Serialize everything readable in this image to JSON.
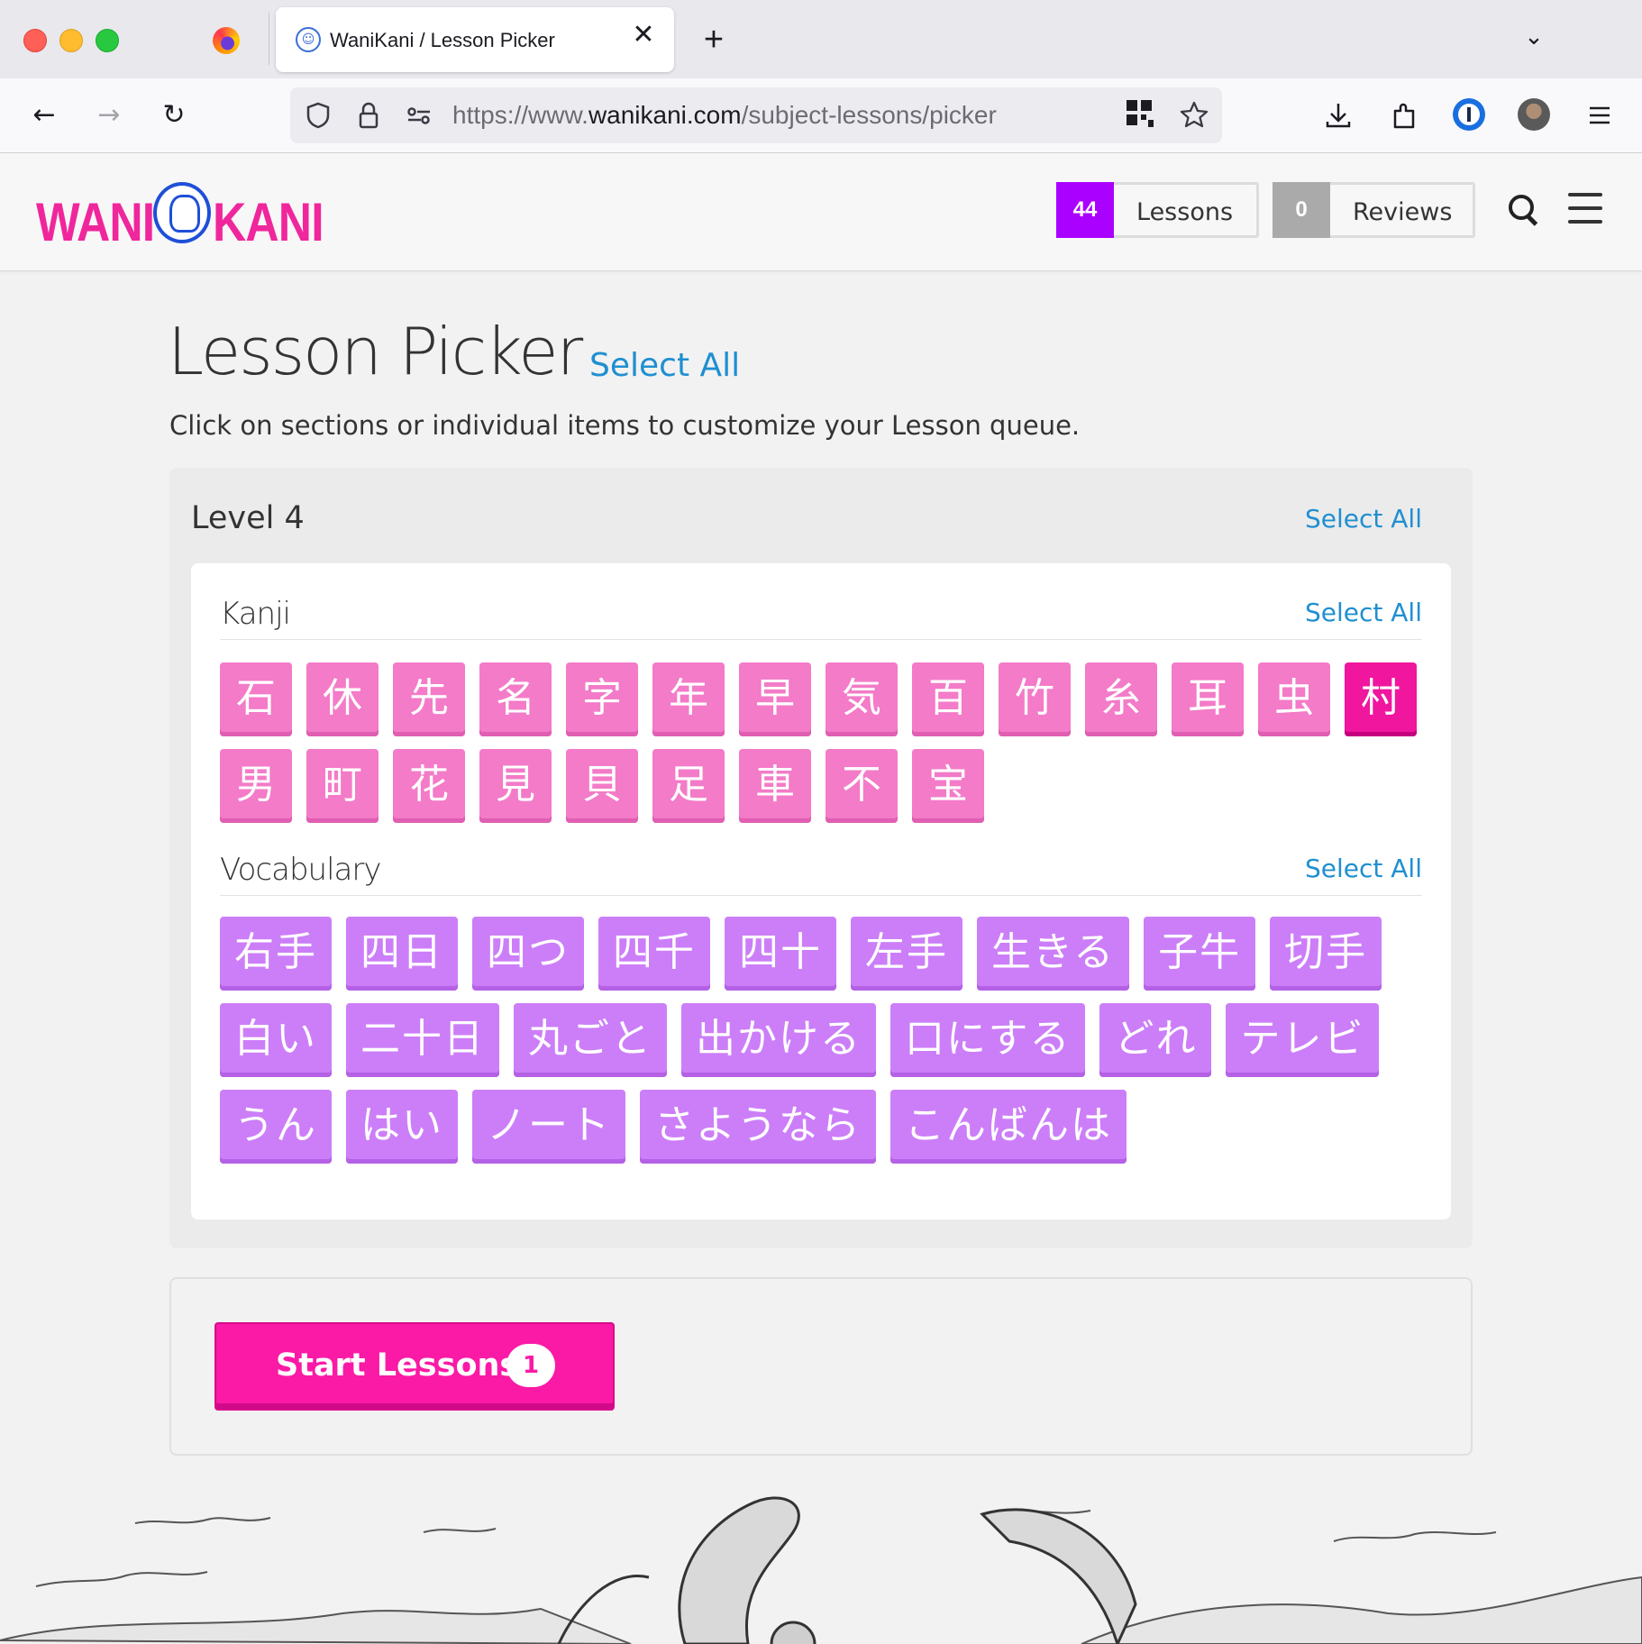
{
  "browser": {
    "tab_title": "WaniKani / Lesson Picker",
    "tab_close_glyph": "✕",
    "new_tab_glyph": "+",
    "tab_list_glyph": "⌄",
    "url_prefix": "https://www.",
    "url_host": "wanikani.com",
    "url_path": "/subject-lessons/picker",
    "nav": {
      "back": "←",
      "forward": "→",
      "reload": "↻"
    }
  },
  "header": {
    "logo_left": "WANI",
    "logo_right": "KANI",
    "lessons_count": "44",
    "lessons_label": "Lessons",
    "reviews_count": "0",
    "reviews_label": "Reviews",
    "colors": {
      "brand_pink": "#f0269c",
      "lessons_purple": "#aa00ff",
      "reviews_gray": "#aaaaaa"
    }
  },
  "main": {
    "title": "Lesson Picker",
    "select_all": "Select All",
    "description": "Click on sections or individual items to customize your Lesson queue.",
    "level": {
      "title": "Level 4",
      "select_all": "Select All",
      "kanji": {
        "title": "Kanji",
        "select_all": "Select All",
        "items": [
          "石",
          "休",
          "先",
          "名",
          "字",
          "年",
          "早",
          "気",
          "百",
          "竹",
          "糸",
          "耳",
          "虫",
          "村",
          "男",
          "町",
          "花",
          "見",
          "貝",
          "足",
          "車",
          "不",
          "宝"
        ],
        "selected": [
          "村"
        ]
      },
      "vocabulary": {
        "title": "Vocabulary",
        "select_all": "Select All",
        "items": [
          "右手",
          "四日",
          "四つ",
          "四千",
          "四十",
          "左手",
          "生きる",
          "子牛",
          "切手",
          "白い",
          "二十日",
          "丸ごと",
          "出かける",
          "口にする",
          "どれ",
          "テレビ",
          "うん",
          "はい",
          "ノート",
          "さようなら",
          "こんばんは"
        ]
      }
    },
    "start_button": {
      "label": "Start Lessons",
      "count": "1"
    }
  }
}
